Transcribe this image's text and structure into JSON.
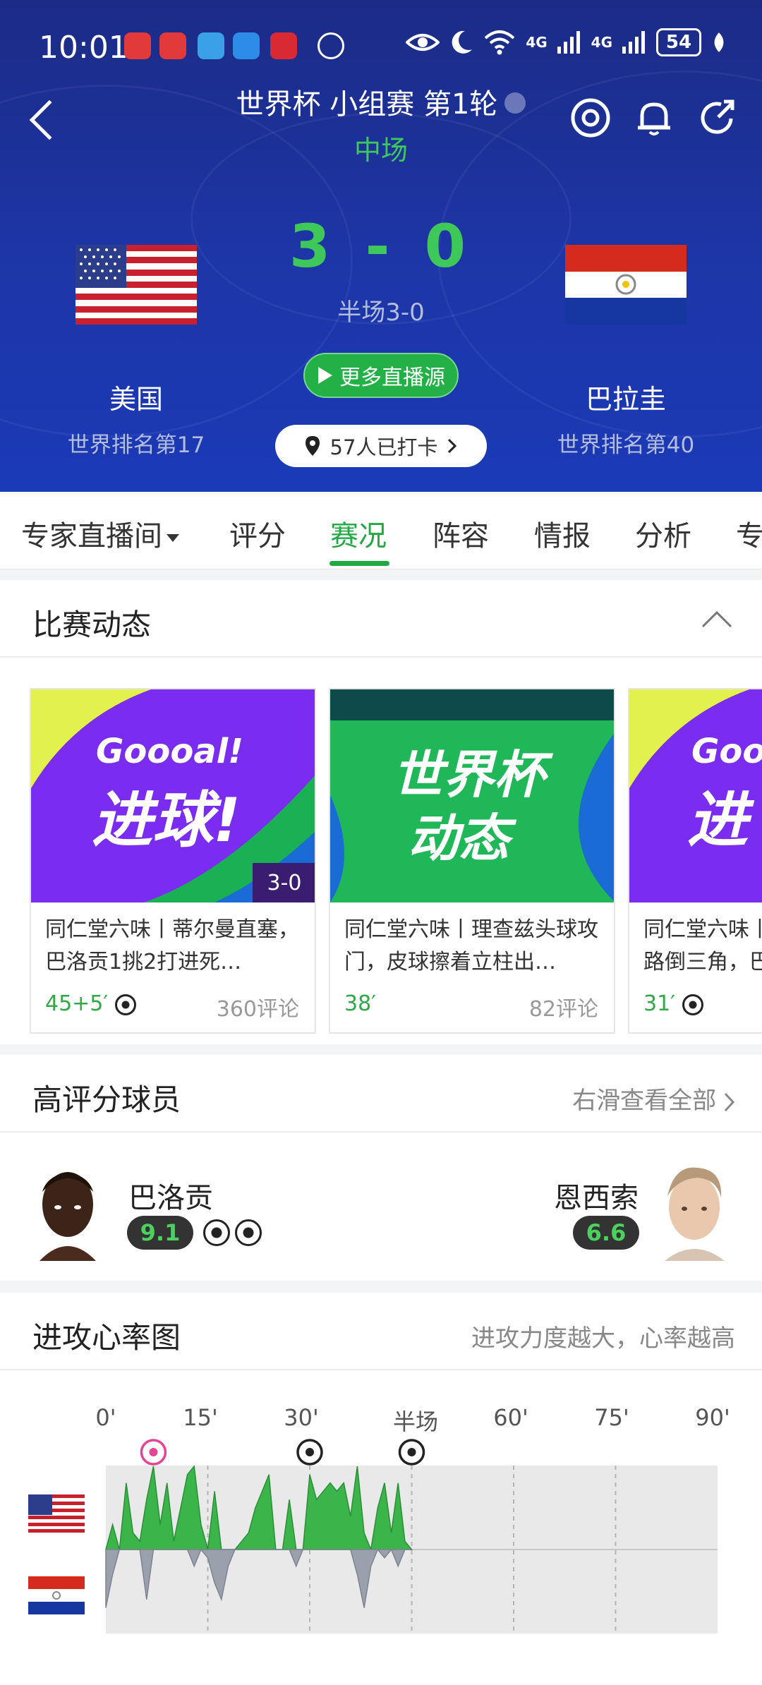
{
  "status_bar": {
    "time": "10:01",
    "battery": "54",
    "signal1": "4G",
    "signal2": "4G"
  },
  "match": {
    "title": "世界杯 小组赛 第1轮",
    "phase": "中场",
    "score": "3 - 0",
    "half_score": "半场3-0",
    "more_streams": "更多直播源",
    "checkin": "57人已打卡",
    "home": {
      "name": "美国",
      "rank": "世界排名第17"
    },
    "away": {
      "name": "巴拉圭",
      "rank": "世界排名第40"
    }
  },
  "tabs": [
    {
      "label": "专家直播间"
    },
    {
      "label": "评分"
    },
    {
      "label": "赛况"
    },
    {
      "label": "阵容"
    },
    {
      "label": "情报"
    },
    {
      "label": "分析"
    },
    {
      "label": "专"
    }
  ],
  "dynamics": {
    "title": "比赛动态",
    "cards": [
      {
        "art_line1": "Goooal!",
        "art_line2": "进球!",
        "badge": "3-0",
        "desc": "同仁堂六味丨蒂尔曼直塞，巴洛贡1挑2打进死…",
        "minute": "45+5′",
        "comments": "360评论"
      },
      {
        "art_line1": "世界杯",
        "art_line2": "动态",
        "badge": "",
        "desc": "同仁堂六味丨理查兹头球攻门，皮球擦着立柱出…",
        "minute": "38′",
        "comments": "82评论"
      },
      {
        "art_line1": "Goo",
        "art_line2": "进",
        "badge": "",
        "desc": "同仁堂六味丨路倒三角，巴",
        "minute": "31′",
        "comments": ""
      }
    ]
  },
  "top_players": {
    "title": "高评分球员",
    "right_link": "右滑查看全部",
    "home": {
      "name": "巴洛贡",
      "rating": "9.1",
      "goals": 2
    },
    "away": {
      "name": "恩西索",
      "rating": "6.6",
      "goals": 0
    }
  },
  "attack_chart": {
    "title": "进攻心率图",
    "subtitle": "进攻力度越大，心率越高",
    "ticks": [
      "0'",
      "15'",
      "30'",
      "半场",
      "60'",
      "75'",
      "90'"
    ]
  },
  "chart_data": {
    "type": "area",
    "x_unit": "minute",
    "xlim": [
      0,
      90
    ],
    "x": [
      0,
      1,
      2,
      3,
      4,
      5,
      6,
      7,
      8,
      9,
      10,
      11,
      12,
      13,
      14,
      15,
      16,
      17,
      18,
      19,
      20,
      21,
      22,
      23,
      24,
      25,
      26,
      27,
      28,
      29,
      30,
      31,
      32,
      33,
      34,
      35,
      36,
      37,
      38,
      39,
      40,
      41,
      42,
      43,
      44,
      45
    ],
    "series": [
      {
        "values": [
          0,
          30,
          0,
          80,
          20,
          10,
          60,
          100,
          30,
          80,
          10,
          50,
          90,
          100,
          30,
          0,
          70,
          0,
          0,
          0,
          10,
          20,
          50,
          70,
          90,
          0,
          0,
          60,
          0,
          0,
          90,
          60,
          70,
          80,
          70,
          80,
          40,
          100,
          20,
          0,
          50,
          80,
          20,
          80,
          10,
          0
        ]
      },
      {
        "values": [
          -70,
          -30,
          0,
          0,
          0,
          0,
          -60,
          0,
          0,
          0,
          0,
          0,
          0,
          -20,
          0,
          -10,
          -40,
          -60,
          -20,
          0,
          0,
          0,
          0,
          0,
          0,
          0,
          0,
          0,
          -20,
          0,
          0,
          0,
          0,
          0,
          0,
          0,
          0,
          -30,
          -70,
          -20,
          0,
          -10,
          0,
          -20,
          0,
          0
        ]
      }
    ],
    "goals": [
      {
        "minute": 7,
        "team": "home"
      },
      {
        "minute": 30,
        "team": "home"
      },
      {
        "minute": 45,
        "team": "home"
      }
    ],
    "ylim": [
      -100,
      100
    ]
  }
}
